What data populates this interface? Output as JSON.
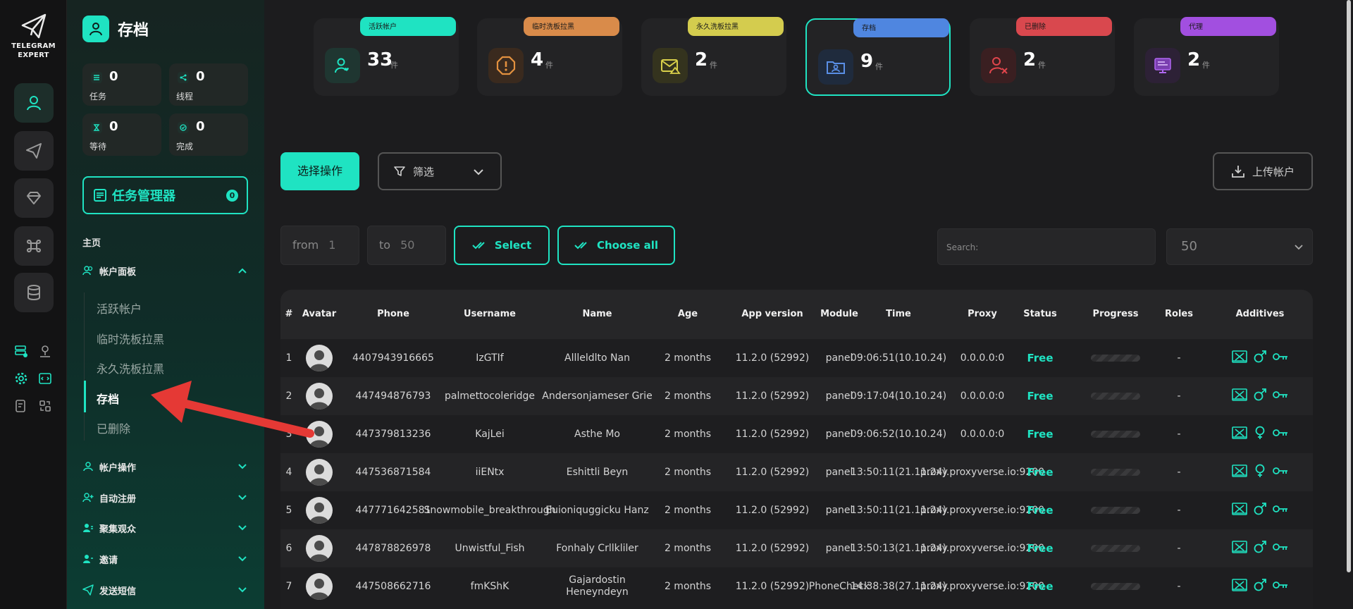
{
  "app": {
    "logo_line1": "TELEGRAM",
    "logo_line2": "EXPERT"
  },
  "sidebar": {
    "title": "存档",
    "stats": [
      {
        "value": "0",
        "label": "任务"
      },
      {
        "value": "0",
        "label": "线程"
      },
      {
        "value": "0",
        "label": "等待"
      },
      {
        "value": "0",
        "label": "完成"
      }
    ],
    "task_manager": {
      "label": "任务管理器",
      "badge": "0"
    },
    "section_label": "主页",
    "groups": [
      {
        "label": "帐户面板"
      },
      {
        "label": "帐户操作"
      },
      {
        "label": "自动注册"
      },
      {
        "label": "聚集观众"
      },
      {
        "label": "邀请"
      },
      {
        "label": "发送短信"
      }
    ],
    "subitems": [
      "活跃帐户",
      "临时洗板拉黑",
      "永久洗板拉黑",
      "存档",
      "已删除"
    ]
  },
  "cards": [
    {
      "tag": "活跃帐户",
      "value": "33",
      "unit": "件",
      "color": "#1fe3c2"
    },
    {
      "tag": "临时洗板拉黑",
      "value": "4",
      "unit": "件",
      "color": "#d98b4a"
    },
    {
      "tag": "永久洗板拉黑",
      "value": "2",
      "unit": "件",
      "color": "#d4cc4e"
    },
    {
      "tag": "存档",
      "value": "9",
      "unit": "件",
      "color": "#4f86e0"
    },
    {
      "tag": "已删除",
      "value": "2",
      "unit": "件",
      "color": "#d9484e"
    },
    {
      "tag": "代理",
      "value": "2",
      "unit": "件",
      "color": "#a24fe0"
    }
  ],
  "toolbar": {
    "select_action": "选择操作",
    "filter": "筛选",
    "upload": "上传帐户",
    "from_label": "from",
    "from_value": "1",
    "to_label": "to",
    "to_value": "50",
    "select": "Select",
    "choose_all": "Choose all",
    "search_placeholder": "Search:",
    "page_size": "50"
  },
  "table": {
    "columns": [
      "#",
      "Avatar",
      "Phone",
      "Username",
      "Name",
      "Age",
      "App version",
      "Module",
      "Time",
      "Proxy",
      "Status",
      "Progress",
      "Roles",
      "Additives"
    ],
    "rows": [
      {
        "idx": "1",
        "phone": "4407943916665",
        "username": "IzGTIf",
        "name": "Allleldlto Nan",
        "age": "2 months",
        "app": "11.2.0 (52992)",
        "module": "panel",
        "time": "09:06:51(10.10.24)",
        "proxy": "0.0.0.0:0",
        "status": "Free",
        "roles": "-",
        "gender": "male"
      },
      {
        "idx": "2",
        "phone": "447494876793",
        "username": "palmettocoleridge",
        "name": "Andersonjameser Grie",
        "age": "2 months",
        "app": "11.2.0 (52992)",
        "module": "panel",
        "time": "09:17:04(10.10.24)",
        "proxy": "0.0.0.0:0",
        "status": "Free",
        "roles": "-",
        "gender": "male"
      },
      {
        "idx": "3",
        "phone": "447379813236",
        "username": "KajLei",
        "name": "Asthe Mo",
        "age": "2 months",
        "app": "11.2.0 (52992)",
        "module": "panel",
        "time": "09:06:52(10.10.24)",
        "proxy": "0.0.0.0:0",
        "status": "Free",
        "roles": "-",
        "gender": "female"
      },
      {
        "idx": "4",
        "phone": "447536871584",
        "username": "iiENtx",
        "name": "Eshittli Beyn",
        "age": "2 months",
        "app": "11.2.0 (52992)",
        "module": "panel",
        "time": "13:50:11(21.11.24)",
        "proxy": "proxy.proxyverse.io:9200",
        "status": "Free",
        "roles": "-",
        "gender": "female"
      },
      {
        "idx": "5",
        "phone": "447771642581",
        "username": "Snowmobile_breakthrough",
        "name": "Euioniquggicku Hanz",
        "age": "2 months",
        "app": "11.2.0 (52992)",
        "module": "panel",
        "time": "13:50:11(21.11.24)",
        "proxy": "proxy.proxyverse.io:9200",
        "status": "Free",
        "roles": "-",
        "gender": "male"
      },
      {
        "idx": "6",
        "phone": "447878826978",
        "username": "Unwistful_Fish",
        "name": "Fonhaly Crllkliler",
        "age": "2 months",
        "app": "11.2.0 (52992)",
        "module": "panel",
        "time": "13:50:13(21.11.24)",
        "proxy": "proxy.proxyverse.io:9200",
        "status": "Free",
        "roles": "-",
        "gender": "male"
      },
      {
        "idx": "7",
        "phone": "447508662716",
        "username": "fmKShK",
        "name": "Gajardostin Heneyndeyn",
        "age": "2 months",
        "app": "11.2.0 (52992)",
        "module": "PhoneCheck",
        "time": "14:38:38(27.11.24)",
        "proxy": "proxy.proxyverse.io:9200",
        "status": "Free",
        "roles": "-",
        "gender": "male"
      }
    ]
  }
}
